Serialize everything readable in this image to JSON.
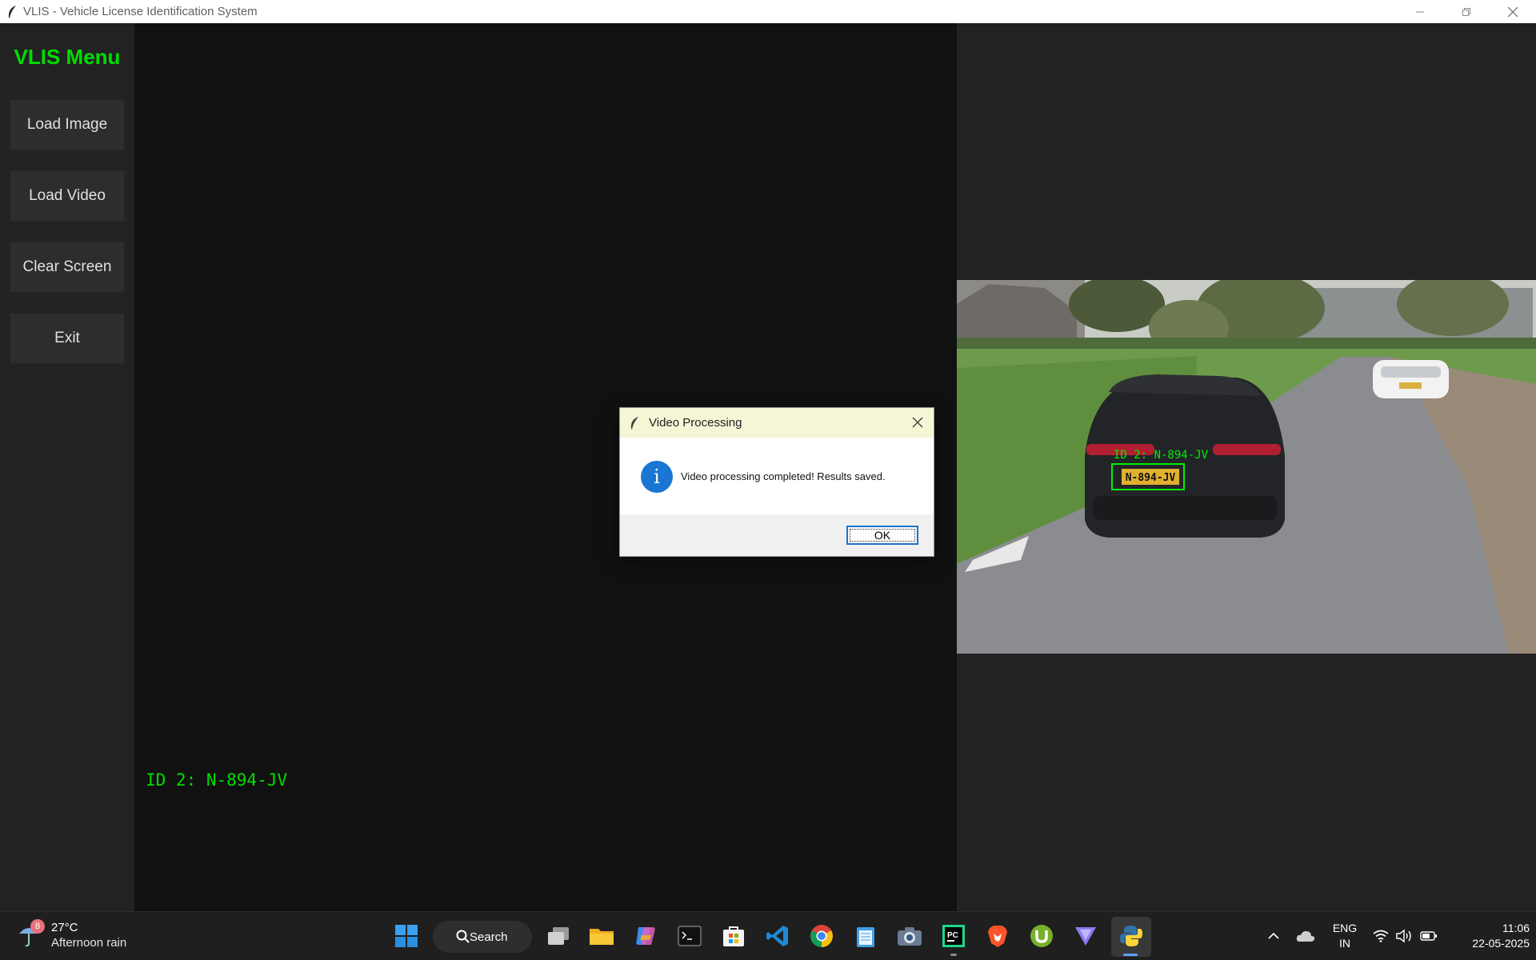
{
  "window": {
    "title": "VLIS - Vehicle License Identification System"
  },
  "sidebar": {
    "title": "VLIS Menu",
    "buttons": [
      {
        "label": "Load Image"
      },
      {
        "label": "Load Video"
      },
      {
        "label": "Clear Screen"
      },
      {
        "label": "Exit"
      }
    ]
  },
  "main": {
    "detected_plate": "ID 2: N-894-JV"
  },
  "video": {
    "overlay_label": "ID 2: N-894-JV",
    "plate_text": "N-894-JV",
    "box_color": "#00ee00"
  },
  "dialog": {
    "title": "Video Processing",
    "message": "Video processing completed! Results saved.",
    "ok_label": "OK",
    "icon": "info-icon"
  },
  "taskbar": {
    "weather": {
      "badge": "8",
      "temperature": "27°C",
      "condition": "Afternoon rain"
    },
    "search_label": "Search",
    "apps": [
      "start-icon",
      "task-view-icon",
      "file-explorer-icon",
      "copilot-icon",
      "terminal-icon",
      "microsoft-store-icon",
      "vscode-icon",
      "chrome-icon",
      "notepad-icon",
      "camera-icon",
      "pycharm-icon",
      "brave-icon",
      "utorrent-icon",
      "vpn-icon",
      "python-icon"
    ],
    "tray": {
      "language_line1": "ENG",
      "language_line2": "IN",
      "time": "11:06",
      "date": "22-05-2025"
    }
  },
  "colors": {
    "accent_green": "#00dd00",
    "sidebar_bg": "#222222",
    "main_bg": "#111111",
    "dialog_title_bg": "#f4f6d6",
    "info_blue": "#1976d2"
  }
}
